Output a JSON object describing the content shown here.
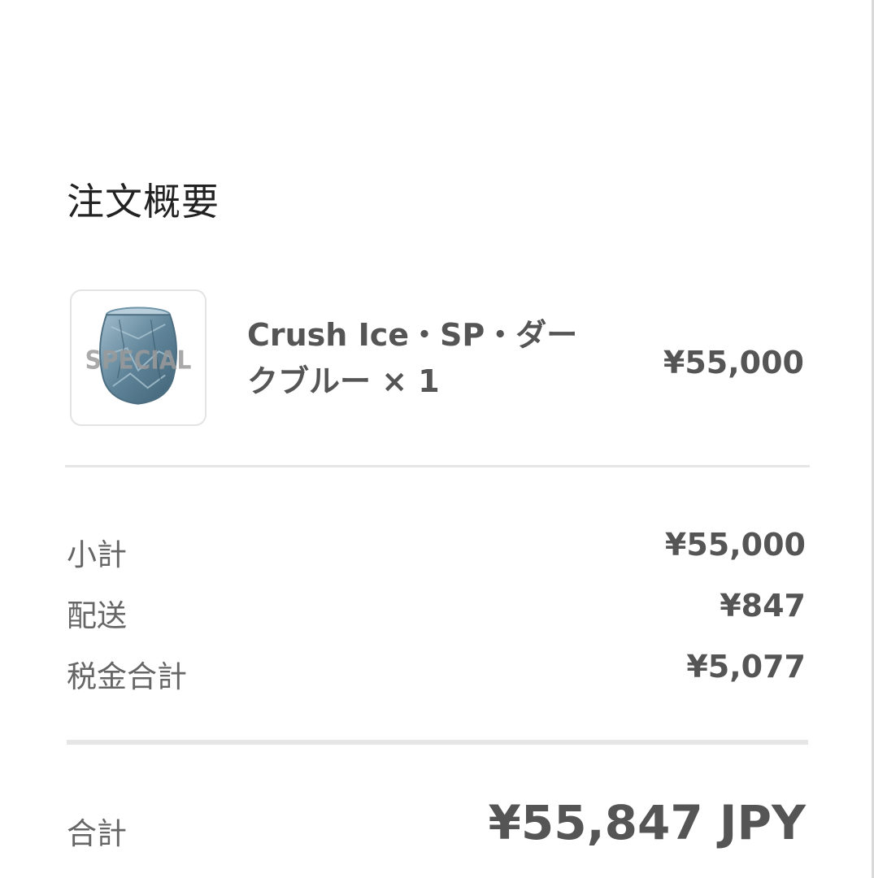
{
  "summary": {
    "title": "注文概要"
  },
  "item": {
    "image_icon": "product-glass-thumbnail",
    "image_overlay_text": "SPECIAL",
    "name_line1": "Crush Ice・SP・ダー",
    "name_line2": "クブルー × 1",
    "price": "¥55,000"
  },
  "rows": [
    {
      "label": "小計",
      "value": "¥55,000"
    },
    {
      "label": "配送",
      "value": "¥847"
    },
    {
      "label": "税金合計",
      "value": "¥5,077"
    }
  ],
  "total": {
    "label": "合計",
    "value": "¥55,847 JPY"
  },
  "colors": {
    "glass": "#6f93a8",
    "divider": "#e6e6e6",
    "text": "#555555"
  }
}
